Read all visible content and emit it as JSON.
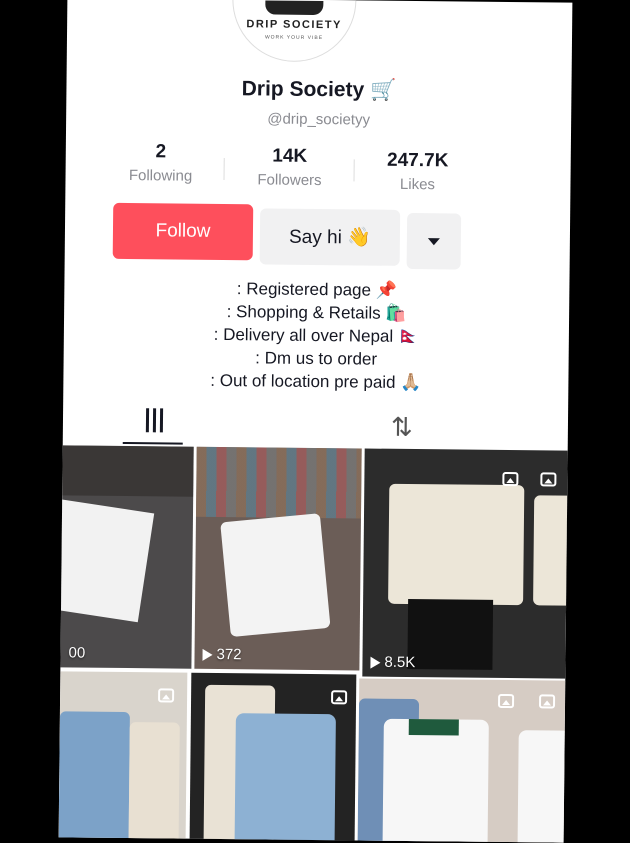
{
  "profile": {
    "logo": {
      "brand": "DRIP SOCIETY",
      "tagline": "WORK YOUR VIBE"
    },
    "name": "Drip Society 🛒",
    "handle": "@drip_societyy"
  },
  "stats": [
    {
      "value": "2",
      "label": "Following"
    },
    {
      "value": "14K",
      "label": "Followers"
    },
    {
      "value": "247.7K",
      "label": "Likes"
    }
  ],
  "actions": {
    "follow": "Follow",
    "say_hi": "Say hi 👋"
  },
  "bio": [
    ": Registered page 📌",
    ": Shopping & Retails 🛍️",
    ": Delivery all over Nepal 🇳🇵",
    ": Dm us to order",
    ": Out of location pre paid 🙏🏼"
  ],
  "videos": [
    {
      "views": "00"
    },
    {
      "views": "372"
    },
    {
      "views": "8.5K"
    }
  ],
  "colors": {
    "follow": "#fe4f5c",
    "text": "#161823",
    "muted": "#8a8b91"
  }
}
